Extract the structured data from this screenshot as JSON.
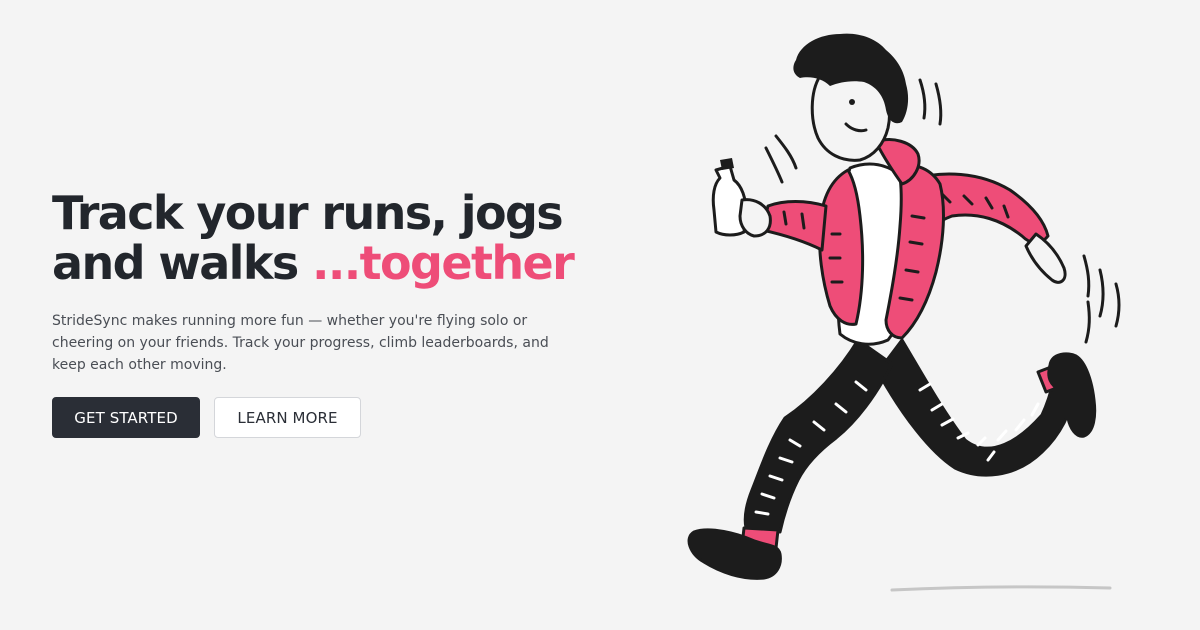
{
  "hero": {
    "heading_line1": "Track your runs, jogs",
    "heading_line2_main": "and walks ",
    "heading_line2_accent": "...together",
    "description": "StrideSync makes running more fun — whether you're flying solo or cheering on your friends. Track your progress, climb leaderboards, and keep each other moving."
  },
  "buttons": {
    "primary_label": "GET STARTED",
    "secondary_label": "LEARN MORE"
  },
  "illustration": {
    "icon": "running-person-illustration"
  },
  "colors": {
    "background": "#f4f4f4",
    "heading": "#22262c",
    "accent": "#ee4d78",
    "body_text": "#4a4e55",
    "primary_button": "#2a2e36",
    "secondary_button": "#ffffff"
  }
}
